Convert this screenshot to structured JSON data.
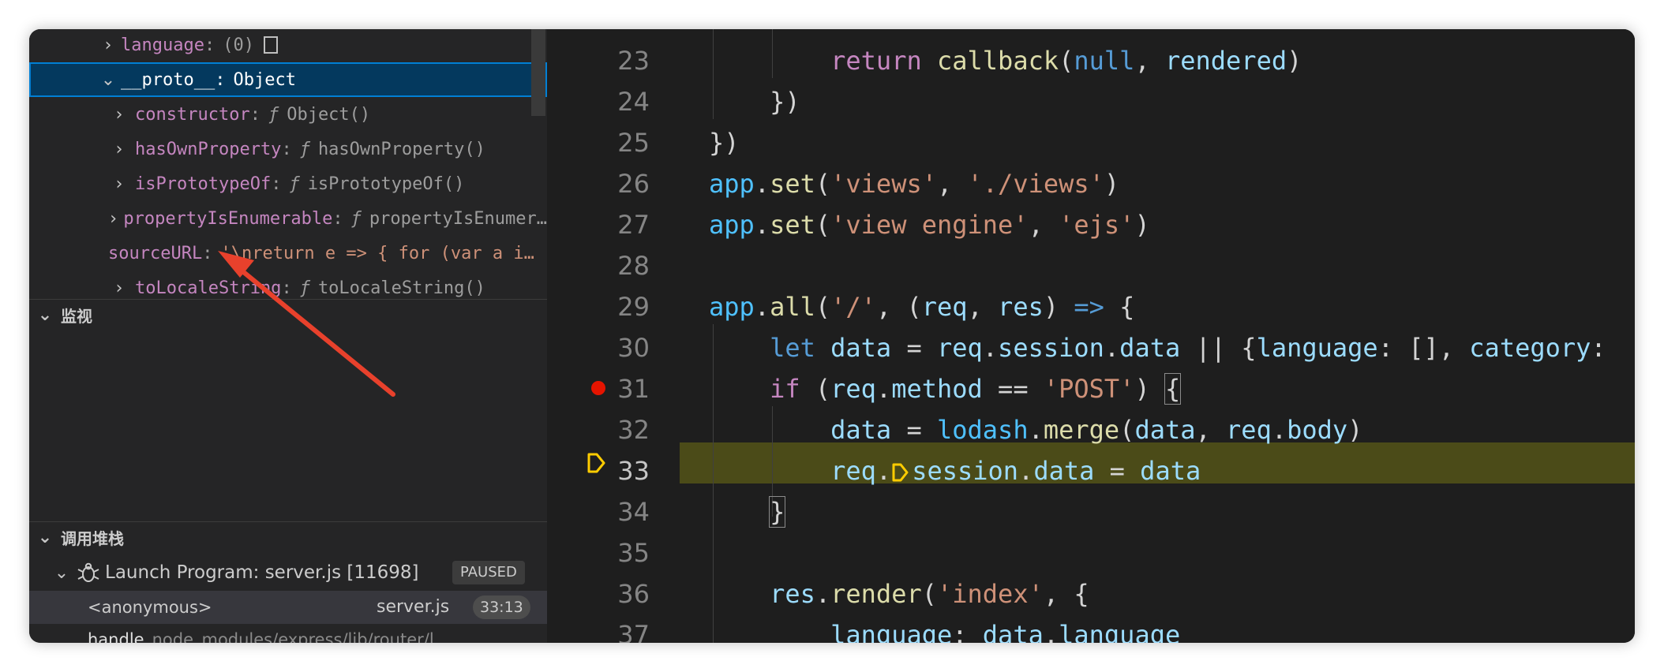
{
  "variables": {
    "rows": [
      {
        "key": "language",
        "sep": ":",
        "value": "(0)",
        "has_box": true,
        "expandable": true
      },
      {
        "key": "__proto__",
        "sep": ":",
        "value": "Object",
        "expandable": true,
        "expanded": true,
        "selected": true
      },
      {
        "key": "constructor",
        "sep": ":",
        "fn_marker": "ƒ",
        "value": "Object()",
        "expandable": true
      },
      {
        "key": "hasOwnProperty",
        "sep": ":",
        "fn_marker": "ƒ",
        "value": "hasOwnProperty()",
        "expandable": true
      },
      {
        "key": "isPrototypeOf",
        "sep": ":",
        "fn_marker": "ƒ",
        "value": "isPrototypeOf()",
        "expandable": true
      },
      {
        "key": "propertyIsEnumerable",
        "sep": ":",
        "fn_marker": "ƒ",
        "value": "propertyIsEnumer…",
        "expandable": true
      },
      {
        "key": "sourceURL",
        "sep": ":",
        "value": "'\\nreturn e => { for (var a i…",
        "expandable": false
      },
      {
        "key": "toLocaleString",
        "sep": ":",
        "fn_marker": "ƒ",
        "value": "toLocaleString()",
        "expandable": true
      }
    ]
  },
  "watch": {
    "title": "监视"
  },
  "callstack": {
    "title": "调用堆栈",
    "thread": {
      "label": "Launch Program: server.js [11698]",
      "badge": "PAUSED"
    },
    "frames": [
      {
        "fn": "<anonymous>",
        "file": "server.js",
        "pos": "33:13"
      },
      {
        "fn": "handle",
        "path": "node_modules/express/lib/router/l…"
      }
    ]
  },
  "editor": {
    "lines": [
      {
        "n": "23"
      },
      {
        "n": "24"
      },
      {
        "n": "25"
      },
      {
        "n": "26"
      },
      {
        "n": "27"
      },
      {
        "n": "28"
      },
      {
        "n": "29"
      },
      {
        "n": "30"
      },
      {
        "n": "31"
      },
      {
        "n": "32"
      },
      {
        "n": "33"
      },
      {
        "n": "34"
      },
      {
        "n": "35"
      },
      {
        "n": "36"
      },
      {
        "n": "37"
      }
    ],
    "breakpoint_line": "31",
    "current_line": "33"
  },
  "colors": {
    "accent": "#007fd4",
    "breakpoint": "#e51400",
    "current_line_bg": "#4b4b18",
    "arrow": "#e8412c"
  },
  "icons": [
    "chevron-right-icon",
    "chevron-down-icon",
    "bug-icon",
    "breakpoint-icon",
    "debug-stack-frame-icon",
    "annotation-arrow-icon"
  ]
}
